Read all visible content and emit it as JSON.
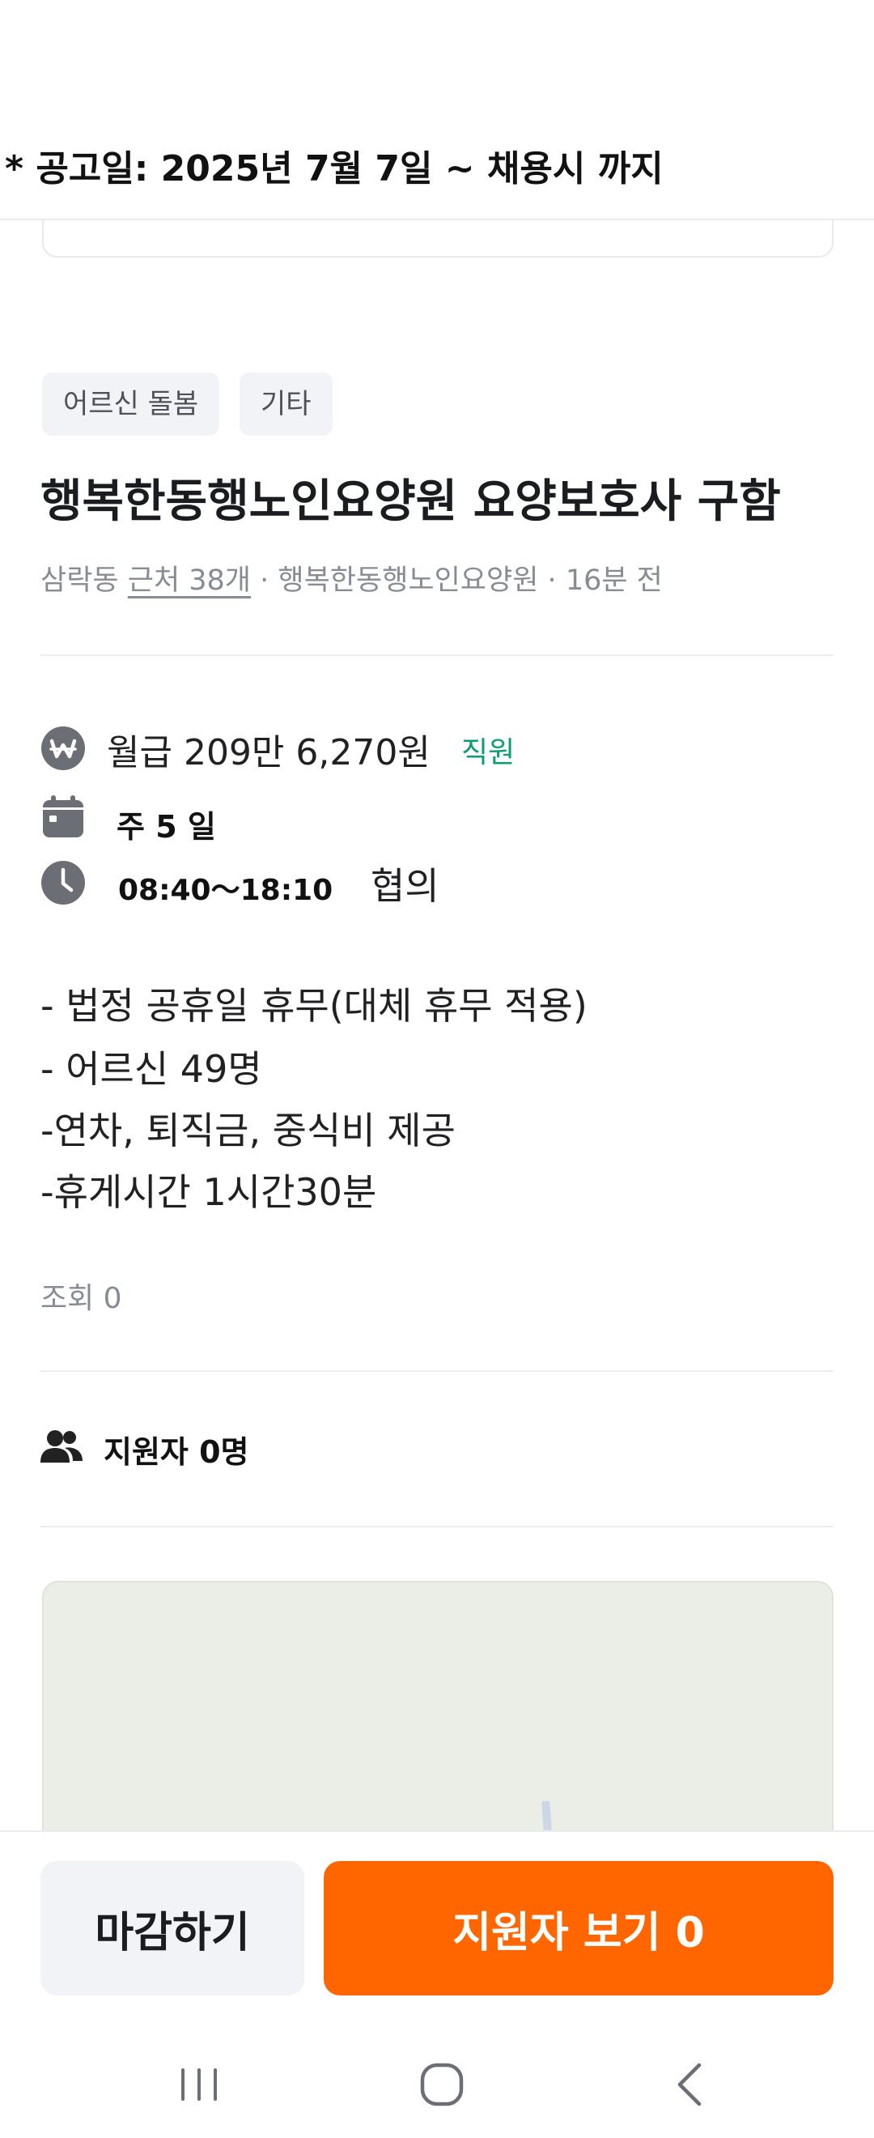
{
  "notice": "* 공고일: 2025년 7월 7일 ~ 채용시 까지",
  "tags": [
    "어르신 돌봄",
    "기타"
  ],
  "job": {
    "title": "행복한동행노인요양원 요양보호사 구함",
    "location": "삼락동",
    "nearby": "근처 38개",
    "employer": "행복한동행노인요양원",
    "posted": "16분 전",
    "separator": " · "
  },
  "info": {
    "wage": "월급 209만 6,270원",
    "wage_type": "직원",
    "days": "주 5 일",
    "hours": "08:40～18:10",
    "hours_note": "협의"
  },
  "description": [
    "- 법정 공휴일 휴무(대체 휴무 적용)",
    "- 어르신 49명",
    "-연차, 퇴직금, 중식비 제공",
    "-휴게시간 1시간30분"
  ],
  "views": "조회 0",
  "applicants": "지원자 0명",
  "actions": {
    "close_label": "마감하기",
    "view_applicants_label": "지원자 보기 0"
  },
  "colors": {
    "accent": "#ff6600",
    "wage_type": "#0aa06e",
    "icon": "#6b6e75"
  },
  "icons": {
    "wage": "won-icon",
    "days": "calendar-icon",
    "hours": "clock-icon",
    "applicants": "people-icon"
  }
}
